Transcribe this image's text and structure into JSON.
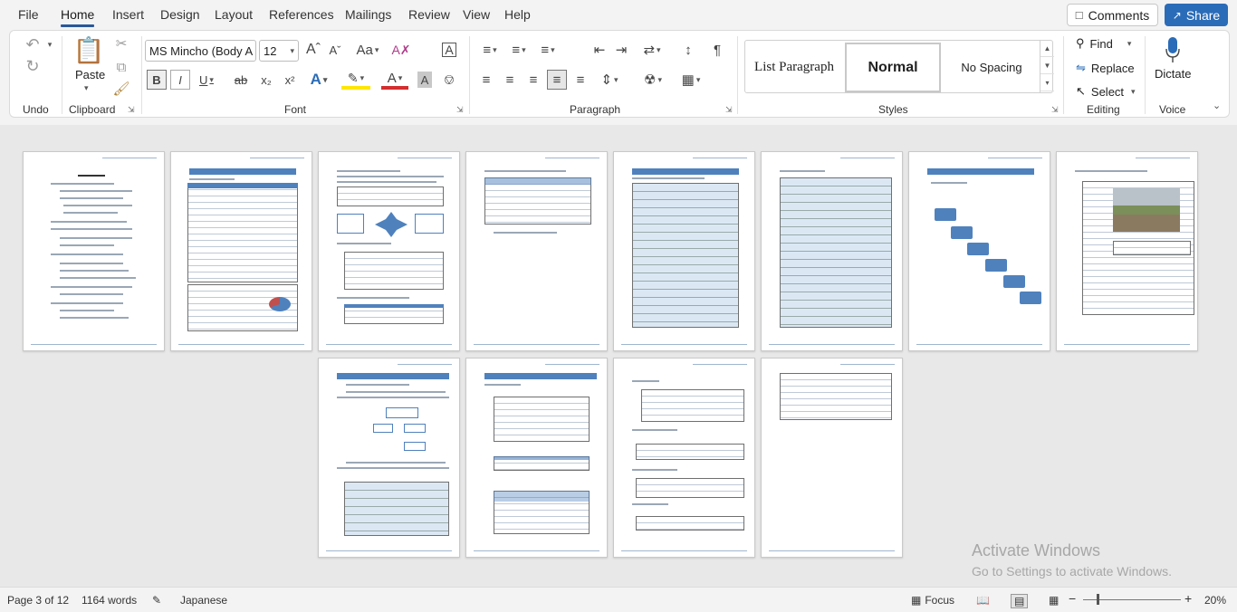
{
  "menu": {
    "tabs": [
      "File",
      "Home",
      "Insert",
      "Design",
      "Layout",
      "References",
      "Mailings",
      "Review",
      "View",
      "Help"
    ],
    "active_tab": "Home",
    "comments_label": "Comments",
    "share_label": "Share"
  },
  "ribbon": {
    "undo": {
      "group_label": "Undo"
    },
    "clipboard": {
      "group_label": "Clipboard",
      "paste_label": "Paste"
    },
    "font": {
      "group_label": "Font",
      "font_name": "MS Mincho (Body A",
      "font_size": "12"
    },
    "paragraph": {
      "group_label": "Paragraph"
    },
    "styles": {
      "group_label": "Styles",
      "items": [
        "List Paragraph",
        "Normal",
        "No Spacing"
      ],
      "selected": "Normal"
    },
    "editing": {
      "group_label": "Editing",
      "find_label": "Find",
      "replace_label": "Replace",
      "select_label": "Select"
    },
    "voice": {
      "group_label": "Voice",
      "dictate_label": "Dictate"
    }
  },
  "status": {
    "page": "Page 3 of 12",
    "words": "1164 words",
    "language": "Japanese",
    "focus_label": "Focus",
    "zoom": "20%",
    "zoom_fraction": 0.14
  },
  "watermark": {
    "line1": "Activate Windows",
    "line2": "Go to Settings to activate Windows."
  },
  "colors": {
    "accent": "#2b579a",
    "share": "#2b6cb8",
    "table_header": "#4f81bd"
  }
}
